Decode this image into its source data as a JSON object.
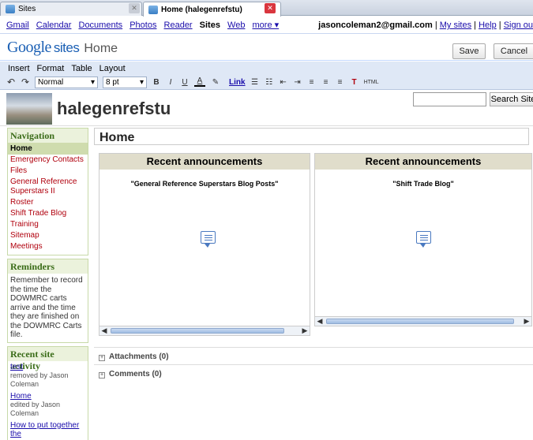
{
  "browser": {
    "tabs": [
      {
        "label": "Sites",
        "active": false
      },
      {
        "label": "Home (halegenrefstu)",
        "active": true
      }
    ]
  },
  "gbar": {
    "links": [
      "Gmail",
      "Calendar",
      "Documents",
      "Photos",
      "Reader"
    ],
    "current": "Sites",
    "more_links": [
      "Web",
      "more ▾"
    ],
    "email": "jasoncoleman2@gmail.com",
    "sep": "|",
    "my_sites": "My sites",
    "help": "Help",
    "sign_out": "Sign ou"
  },
  "header": {
    "logo_google": "Google",
    "logo_sites": "sites",
    "page_word": "Home",
    "save_label": "Save",
    "cancel_label": "Cancel"
  },
  "menubar": {
    "items": [
      "Insert",
      "Format",
      "Table",
      "Layout"
    ]
  },
  "toolbar": {
    "undo": "↶",
    "redo": "↷",
    "style": "Normal",
    "size": "8 pt",
    "bold": "B",
    "italic": "I",
    "underline": "U",
    "link": "Link",
    "html": "HTML",
    "chevron": "▾"
  },
  "site": {
    "name": "halegenrefstu",
    "search_label": "Search Site",
    "search_value": ""
  },
  "sidebar": {
    "nav_title": "Navigation",
    "nav_items": [
      "Home",
      "Emergency Contacts",
      "Files",
      "General Reference Superstars II",
      "Roster",
      "Shift Trade Blog",
      "Training",
      "Sitemap",
      "Meetings"
    ],
    "reminders_title": "Reminders",
    "reminders_text": "Remember to record the time the DOWMRC carts arrive and the time they are finished on the DOWMRC Carts file.",
    "activity_title": "Recent site activity",
    "activity": [
      {
        "link": "test",
        "sub": "removed by Jason Coleman"
      },
      {
        "link": "Home",
        "sub": "edited by Jason Coleman"
      },
      {
        "link": "How to put together the",
        "sub": ""
      }
    ]
  },
  "main": {
    "page_title": "Home",
    "gadgets": [
      {
        "title": "Recent announcements",
        "subtitle": "\"General Reference Superstars Blog Posts\""
      },
      {
        "title": "Recent announcements",
        "subtitle": "\"Shift Trade Blog\""
      }
    ],
    "attachments": "Attachments (0)",
    "comments": "Comments (0)",
    "plus": "+"
  },
  "colors": {
    "nav_link": "#b0000d",
    "sidebar_header": "#3a6c18",
    "gadget_header": "#e0ddcb",
    "close_button": "#d9363e"
  }
}
